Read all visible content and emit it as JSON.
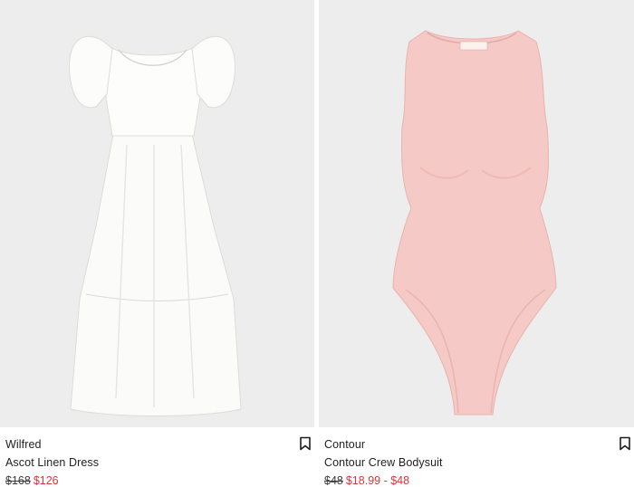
{
  "products": [
    {
      "brand": "Wilfred",
      "name": "Ascot Linen Dress",
      "original_price": "$168",
      "sale_price": "$126",
      "image": "white-linen-dress",
      "icon": "bookmark-icon"
    },
    {
      "brand": "Contour",
      "name": "Contour Crew Bodysuit",
      "original_price": "$48",
      "sale_price": "$18.99 - $48",
      "image": "pink-bodysuit",
      "icon": "bookmark-icon"
    }
  ],
  "colors": {
    "image_background": "#ededed",
    "sale_price": "#d4383a",
    "dress": "#fbfbfa",
    "bodysuit": "#f5c9c5"
  }
}
